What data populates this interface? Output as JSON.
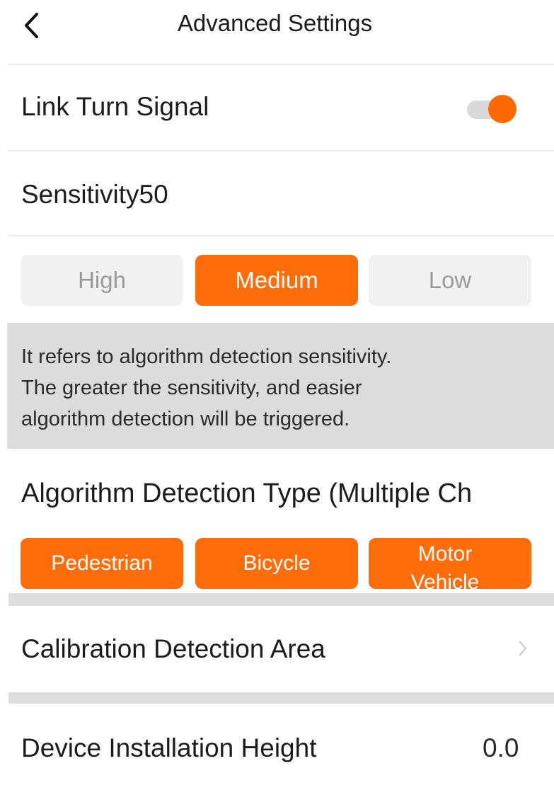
{
  "header": {
    "title": "Advanced Settings",
    "back_icon": "chevron-left-icon"
  },
  "link_turn_signal": {
    "label": "Link Turn Signal",
    "enabled": true,
    "accent_color": "#ff6a00"
  },
  "sensitivity": {
    "label": "Sensitivity50",
    "options": [
      {
        "label": "High",
        "selected": false
      },
      {
        "label": "Medium",
        "selected": true
      },
      {
        "label": "Low",
        "selected": false
      }
    ],
    "description_lines": [
      "It refers to algorithm detection sensitivity.",
      "The greater the sensitivity, and easier",
      "algorithm detection will be triggered."
    ]
  },
  "detection_type": {
    "label": "Algorithm Detection Type (Multiple Ch",
    "options": [
      {
        "label": "Pedestrian",
        "selected": true
      },
      {
        "label": "Bicycle",
        "selected": true
      },
      {
        "label": "Motor Vehicle",
        "selected": true
      }
    ]
  },
  "calibration": {
    "label": "Calibration Detection Area",
    "chevron_icon": "chevron-right-icon"
  },
  "installation_height": {
    "label": "Device Installation Height",
    "value": "0.0"
  },
  "colors": {
    "accent": "#ff6d0a",
    "inactive_button": "#f1f1f1",
    "info_background": "#dcdcdc"
  }
}
